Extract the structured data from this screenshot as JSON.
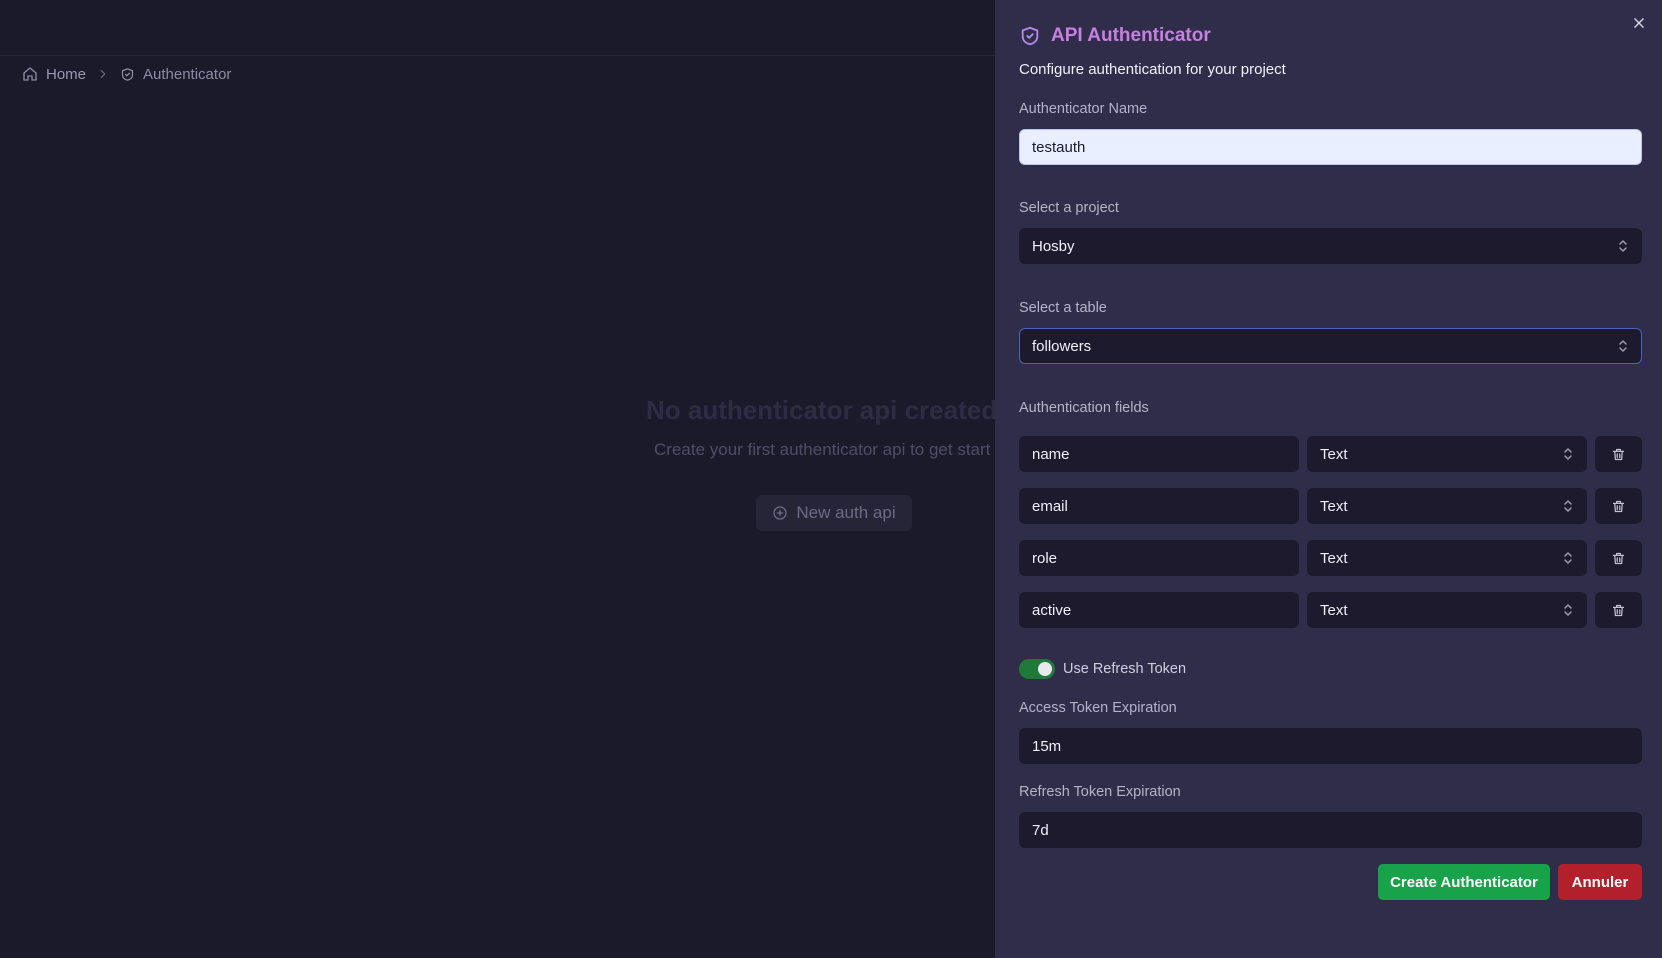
{
  "breadcrumb": {
    "home": "Home",
    "current": "Authenticator"
  },
  "empty_state": {
    "title": "No authenticator api created y",
    "subtitle": "Create your first authenticator api to get start",
    "button": "New auth api"
  },
  "panel": {
    "title": "API Authenticator",
    "subtitle": "Configure authentication for your project",
    "name_label": "Authenticator Name",
    "name_value": "testauth",
    "project_label": "Select a project",
    "project_value": "Hosby",
    "table_label": "Select a table",
    "table_value": "followers",
    "fields_label": "Authentication fields",
    "fields": [
      {
        "name": "name",
        "type": "Text"
      },
      {
        "name": "email",
        "type": "Text"
      },
      {
        "name": "role",
        "type": "Text"
      },
      {
        "name": "active",
        "type": "Text"
      }
    ],
    "refresh_toggle_label": "Use Refresh Token",
    "refresh_enabled": true,
    "access_label": "Access Token Expiration",
    "access_value": "15m",
    "refresh_label": "Refresh Token Expiration",
    "refresh_value": "7d",
    "create_button": "Create Authenticator",
    "cancel_button": "Annuler"
  },
  "colors": {
    "accent_title": "#c77fe0",
    "create_button": "#18a34a",
    "cancel_button": "#b3202c",
    "toggle_on": "#1f7a3a"
  }
}
